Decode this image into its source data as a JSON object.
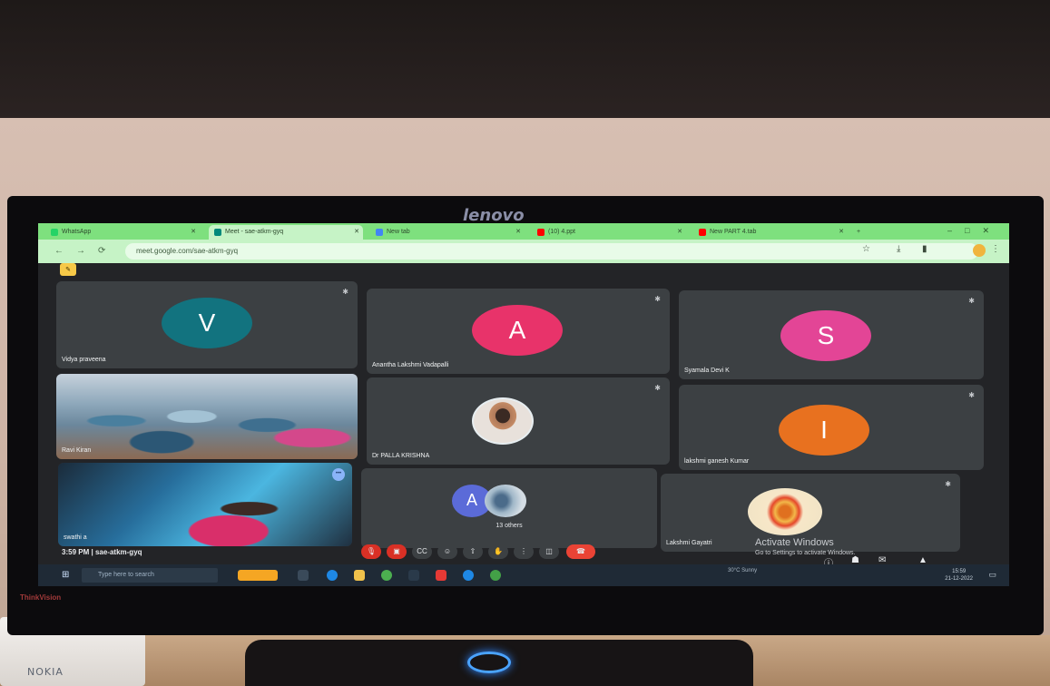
{
  "device": {
    "brand": "lenovo",
    "model_badge": "ThinkVision",
    "phone_brand": "NOKIA"
  },
  "browser": {
    "tabs": [
      {
        "label": "WhatsApp",
        "icon_color": "#25d366",
        "active": false
      },
      {
        "label": "Meet - sae-atkm-gyq",
        "icon_color": "#00897b",
        "active": true
      },
      {
        "label": "New tab",
        "icon_color": "#4285f4",
        "active": false
      },
      {
        "label": "(10) 4.ppt",
        "icon_color": "#ff0000",
        "active": false
      },
      {
        "label": "New PART 4.tab",
        "icon_color": "#ff0000",
        "active": false
      }
    ],
    "url": "meet.google.com/sae-atkm-gyq"
  },
  "meet": {
    "tiles": [
      {
        "name": "Vidya praveena",
        "initial": "V",
        "color": "#12737f"
      },
      {
        "name": "Anantha Lakshmi Vadapalli",
        "initial": "A",
        "color": "#e8336a"
      },
      {
        "name": "Syamala Devi K",
        "initial": "S",
        "color": "#e34596"
      },
      {
        "name": "Ravi Kiran",
        "type": "video"
      },
      {
        "name": "Dr PALLA KRISHNA",
        "type": "photo"
      },
      {
        "name": "lakshmi ganesh Kumar",
        "initial": "I",
        "color": "#e8711f"
      },
      {
        "name": "swathi a",
        "type": "video"
      },
      {
        "name": "",
        "type": "others",
        "initial": "A",
        "label": "13 others"
      },
      {
        "name": "Lakshmi Gayatri",
        "type": "logo"
      }
    ],
    "time": "3:59 PM",
    "separator": "|",
    "code": "sae-atkm-gyq",
    "activate_title": "Activate Windows",
    "activate_sub": "Go to Settings to activate Windows."
  },
  "taskbar": {
    "search_placeholder": "Type here to search",
    "clock_time": "15:59",
    "clock_date": "21-12-2022",
    "weather": "30°C Sunny"
  }
}
